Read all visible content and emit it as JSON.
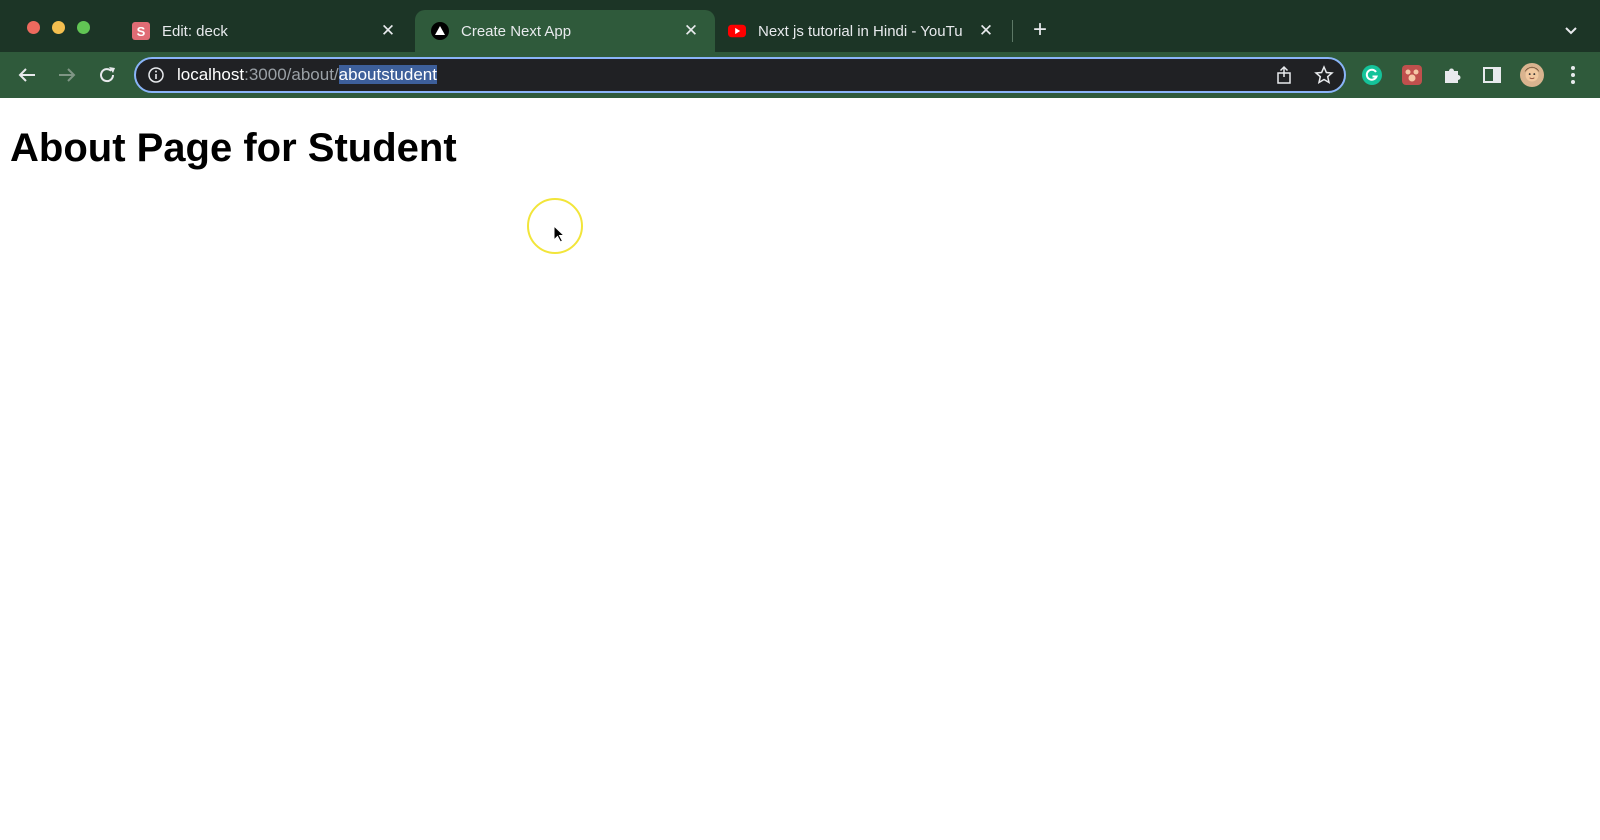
{
  "browser": {
    "tabs": [
      {
        "title": "Edit: deck",
        "favicon": "slides-icon",
        "active": false
      },
      {
        "title": "Create Next App",
        "favicon": "nextjs-triangle-icon",
        "active": true
      },
      {
        "title": "Next js tutorial in Hindi - YouTu",
        "favicon": "youtube-icon",
        "active": false
      }
    ],
    "new_tab_label": "+",
    "address": {
      "host": "localhost",
      "port": ":3000",
      "path": "/about/",
      "selected": "aboutstudent"
    }
  },
  "page": {
    "heading": "About Page for Student"
  },
  "colors": {
    "tab_strip": "#1c3526",
    "toolbar": "#2f5a3b",
    "omnibox": "#202124",
    "omnibox_focus": "#8ab4f8",
    "selection": "#3d5f9a",
    "cursor_highlight": "#f2e53a"
  }
}
